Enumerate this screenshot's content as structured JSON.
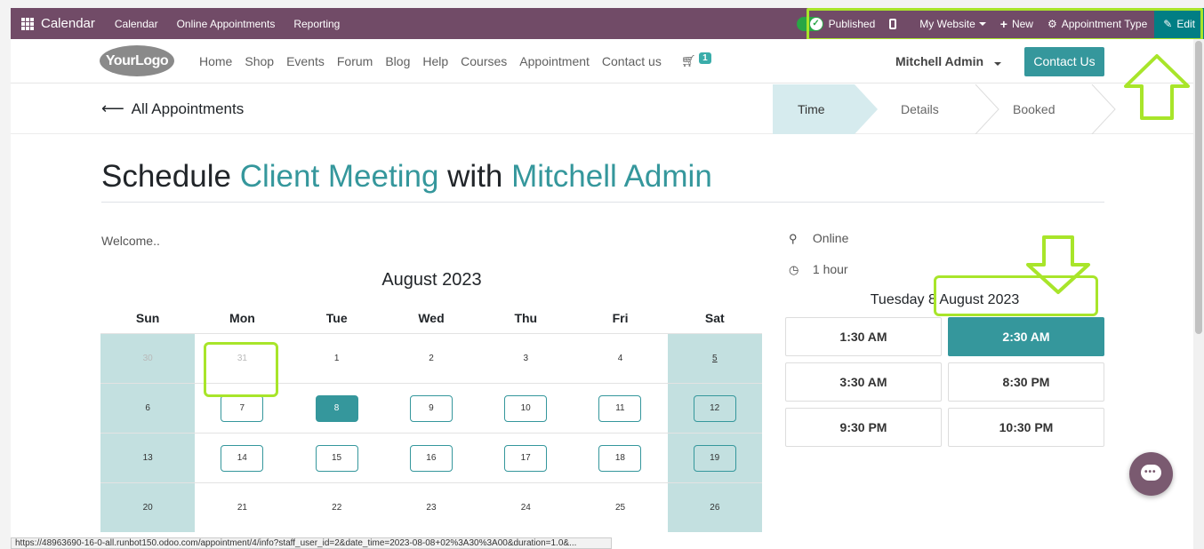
{
  "admin_bar": {
    "brand": "Calendar",
    "menu": [
      "Calendar",
      "Online Appointments",
      "Reporting"
    ],
    "published": "Published",
    "website": "My Website",
    "new": "New",
    "appointment_type": "Appointment Type",
    "edit": "Edit"
  },
  "header": {
    "logo": "YourLogo",
    "nav": [
      "Home",
      "Shop",
      "Events",
      "Forum",
      "Blog",
      "Help",
      "Courses",
      "Appointment",
      "Contact us"
    ],
    "cart_count": "1",
    "user": "Mitchell Admin",
    "contact_button": "Contact Us"
  },
  "steps_bar": {
    "back": "All Appointments",
    "steps": [
      "Time",
      "Details",
      "Booked"
    ],
    "active_step": "Time"
  },
  "title": {
    "prefix": "Schedule",
    "appointment": "Client Meeting",
    "connector": "with",
    "staff": "Mitchell Admin"
  },
  "welcome": "Welcome..",
  "calendar": {
    "month": "August 2023",
    "weekdays": [
      "Sun",
      "Mon",
      "Tue",
      "Wed",
      "Thu",
      "Fri",
      "Sat"
    ],
    "weeks": [
      [
        "30",
        "31",
        "1",
        "2",
        "3",
        "4",
        "5"
      ],
      [
        "6",
        "7",
        "8",
        "9",
        "10",
        "11",
        "12"
      ],
      [
        "13",
        "14",
        "15",
        "16",
        "17",
        "18",
        "19"
      ],
      [
        "20",
        "21",
        "22",
        "23",
        "24",
        "25",
        "26"
      ]
    ],
    "available": [
      "7",
      "8",
      "9",
      "10",
      "11",
      "12",
      "14",
      "15",
      "16",
      "17",
      "18",
      "19"
    ],
    "selected": "8",
    "muted": [
      "30",
      "31"
    ],
    "today": "5"
  },
  "details": {
    "location": "Online",
    "duration": "1 hour",
    "date": "Tuesday 8 August 2023",
    "slots": [
      "1:30 AM",
      "2:30 AM",
      "3:30 AM",
      "8:30 PM",
      "9:30 PM",
      "10:30 PM"
    ],
    "selected_slot": "2:30 AM"
  },
  "status_url": "https://48963690-16-0-all.runbot150.odoo.com/appointment/4/info?staff_user_id=2&date_time=2023-08-08+02%3A30%3A00&duration=1.0&..."
}
